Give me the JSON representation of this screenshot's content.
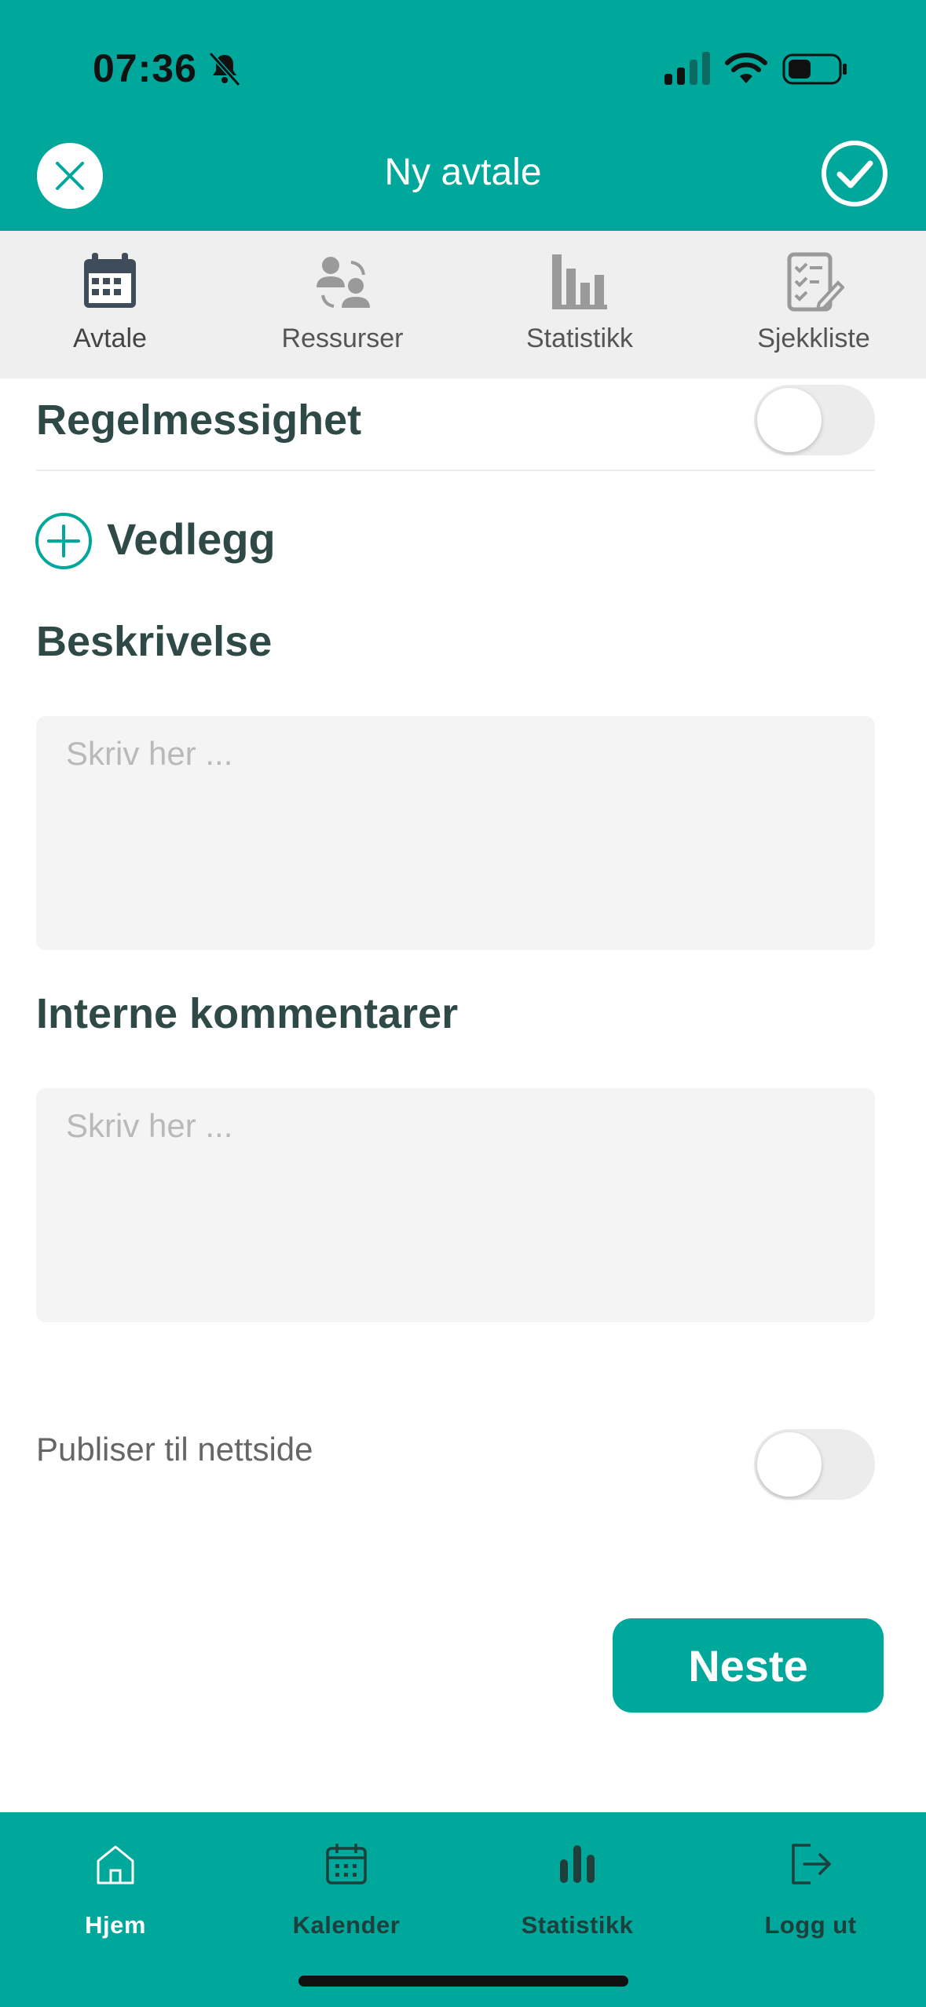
{
  "status_bar": {
    "time": "07:36"
  },
  "header": {
    "title": "Ny avtale"
  },
  "tabs": [
    {
      "label": "Avtale",
      "icon": "calendar-icon"
    },
    {
      "label": "Ressurser",
      "icon": "resources-icon"
    },
    {
      "label": "Statistikk",
      "icon": "bar-chart-icon"
    },
    {
      "label": "Sjekkliste",
      "icon": "checklist-icon"
    }
  ],
  "form": {
    "recurrence_label": "Regelmessighet",
    "attachment_label": "Vedlegg",
    "description_label": "Beskrivelse",
    "description_placeholder": "Skriv her ...",
    "internal_comments_label": "Interne kommentarer",
    "internal_comments_placeholder": "Skriv her ...",
    "publish_label": "Publiser til nettside",
    "next_button": "Neste"
  },
  "bottom_nav": [
    {
      "label": "Hjem",
      "icon": "home-icon"
    },
    {
      "label": "Kalender",
      "icon": "calendar-icon"
    },
    {
      "label": "Statistikk",
      "icon": "bar-chart-icon"
    },
    {
      "label": "Logg ut",
      "icon": "logout-icon"
    }
  ],
  "colors": {
    "accent": "#00a79b",
    "bottom_nav_inactive": "#1e3f3b",
    "bottom_nav_active": "#ffffff"
  }
}
